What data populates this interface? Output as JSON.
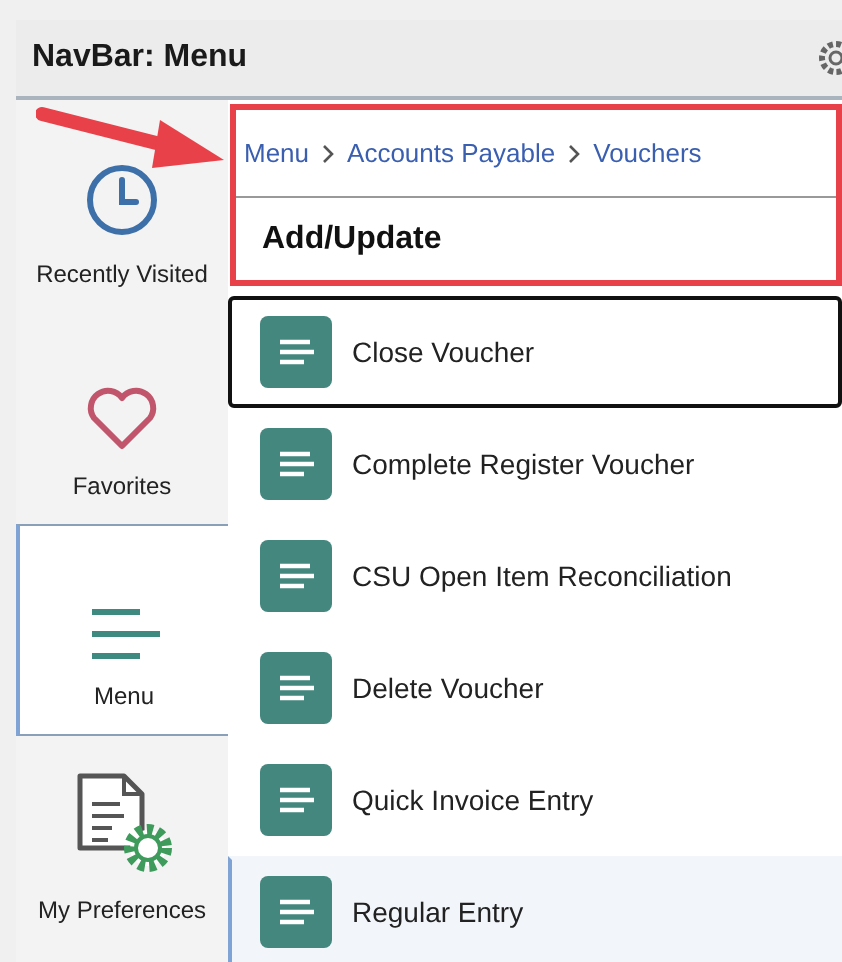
{
  "header": {
    "title": "NavBar: Menu"
  },
  "sidebar": {
    "items": [
      {
        "label": "Recently Visited",
        "kind": "clock",
        "selected": false
      },
      {
        "label": "Favorites",
        "kind": "heart",
        "selected": false
      },
      {
        "label": "Menu",
        "kind": "menu",
        "selected": true
      },
      {
        "label": "My Preferences",
        "kind": "preferences",
        "selected": false
      }
    ]
  },
  "breadcrumb": [
    "Menu",
    "Accounts Payable",
    "Vouchers"
  ],
  "section_title": "Add/Update",
  "items": [
    {
      "label": "Close Voucher",
      "focused": true,
      "selected": false
    },
    {
      "label": "Complete Register Voucher",
      "focused": false,
      "selected": false
    },
    {
      "label": "CSU Open Item Reconciliation",
      "focused": false,
      "selected": false
    },
    {
      "label": "Delete Voucher",
      "focused": false,
      "selected": false
    },
    {
      "label": "Quick Invoice Entry",
      "focused": false,
      "selected": false
    },
    {
      "label": "Regular Entry",
      "focused": false,
      "selected": true
    }
  ]
}
